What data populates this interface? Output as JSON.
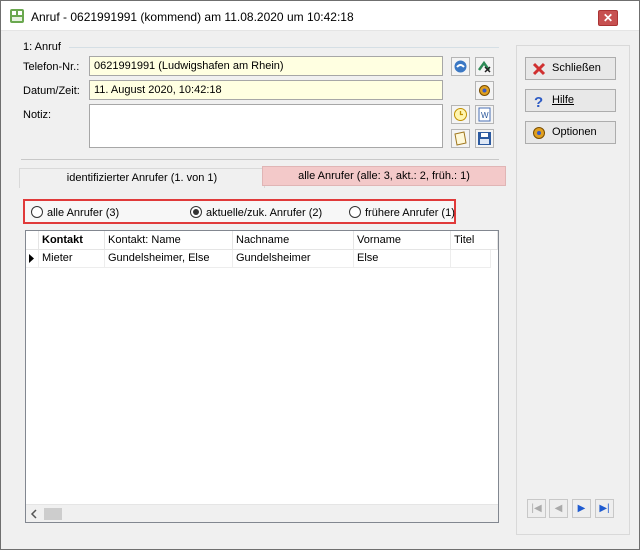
{
  "window": {
    "title": "Anruf - 0621991991 (kommend) am 11.08.2020 um 10:42:18",
    "close_symbol": "✕"
  },
  "call_group": {
    "label": "1: Anruf",
    "phone_label": "Telefon-Nr.:",
    "phone_value": "0621991991  (Ludwigshafen am Rhein)",
    "datetime_label": "Datum/Zeit:",
    "datetime_value": "11. August 2020,  10:42:18",
    "note_label": "Notiz:",
    "note_value": ""
  },
  "side_buttons": {
    "close": "Schließen",
    "help": "Hilfe",
    "options": "Optionen"
  },
  "tabs": {
    "identified": "identifizierter Anrufer  (1. von 1)",
    "all": "alle Anrufer (alle: 3,  akt.: 2,  früh.: 1)"
  },
  "filter": {
    "all": "alle Anrufer (3)",
    "current": "aktuelle/zuk. Anrufer (2)",
    "former": "frühere Anrufer (1)",
    "selected": "current"
  },
  "table": {
    "headers": [
      "Kontakt",
      "Kontakt: Name",
      "Nachname",
      "Vorname",
      "Titel"
    ],
    "rows": [
      [
        "Mieter",
        "Gundelsheimer, Else",
        "Gundelsheimer",
        "Else",
        ""
      ]
    ]
  },
  "nav": {
    "first": "|◀",
    "prev": "◀",
    "next": "▶",
    "last": "▶|"
  },
  "colors": {
    "field_bg": "#ffffe1",
    "highlight_red": "#e03a3a",
    "tab_pink": "#f3c9c9"
  }
}
